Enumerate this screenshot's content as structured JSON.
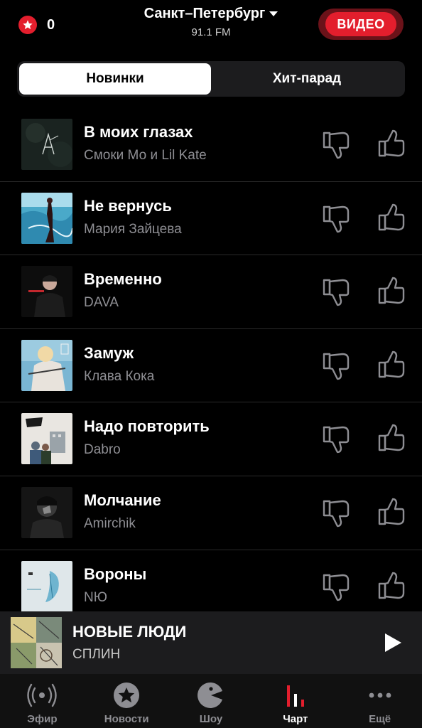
{
  "header": {
    "stars_count": "0",
    "city": "Санкт–Петербург",
    "frequency": "91.1 FM",
    "video_label": "ВИДЕО"
  },
  "segments": [
    {
      "label": "Новинки",
      "active": true
    },
    {
      "label": "Хит-парад",
      "active": false
    }
  ],
  "tracks": [
    {
      "title": "В моих глазах",
      "artist": "Смоки Мо и Lil Kate"
    },
    {
      "title": "Не вернусь",
      "artist": "Мария Зайцева"
    },
    {
      "title": "Временно",
      "artist": "DAVA"
    },
    {
      "title": "Замуж",
      "artist": "Клава Кока"
    },
    {
      "title": "Надо повторить",
      "artist": "Dabro"
    },
    {
      "title": "Молчание",
      "artist": "Amirchik"
    },
    {
      "title": "Вороны",
      "artist": "NЮ"
    }
  ],
  "now_playing": {
    "title": "НОВЫЕ ЛЮДИ",
    "artist": "СПЛИН"
  },
  "tabs": [
    {
      "label": "Эфир",
      "icon": "broadcast-icon"
    },
    {
      "label": "Новости",
      "icon": "star-icon"
    },
    {
      "label": "Шоу",
      "icon": "pacman-icon"
    },
    {
      "label": "Чарт",
      "icon": "chart-icon",
      "active": true
    },
    {
      "label": "Ещё",
      "icon": "more-icon"
    }
  ],
  "colors": {
    "accent": "#e31e2d",
    "background": "#000000",
    "muted_text": "#8e8e93"
  }
}
